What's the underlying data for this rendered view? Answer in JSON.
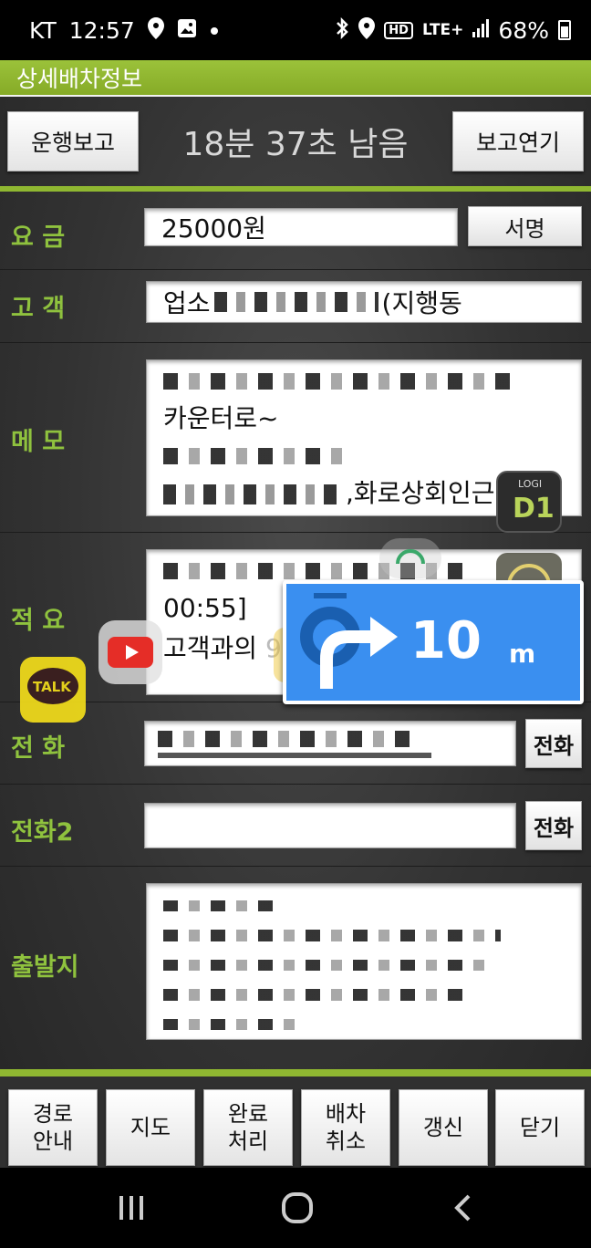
{
  "status_bar": {
    "carrier": "KT",
    "time": "12:57",
    "network": "LTE+",
    "hd": "HD",
    "battery": "68%"
  },
  "app": {
    "title": "상세배차정보",
    "report_button": "운행보고",
    "timer_text": "18분 37초 남음",
    "delay_button": "보고연기"
  },
  "fare": {
    "label": "요 금",
    "value": "25000원",
    "sign_button": "서명"
  },
  "customer": {
    "label": "고 객",
    "prefix": "업소",
    "suffix": "(지행동"
  },
  "memo": {
    "label": "메 모",
    "line2": "카운터로~",
    "line4_suffix": ",화로상회인근"
  },
  "summary": {
    "label": "적 요",
    "line2": "00:55]",
    "line3_prefix": "고객과의",
    "line3_partial": "909"
  },
  "phone": {
    "label": "전 화",
    "call_button": "전화"
  },
  "phone2": {
    "label": "전화2",
    "value": "",
    "call_button": "전화"
  },
  "departure": {
    "label": "출발지"
  },
  "bottom_buttons": [
    {
      "label": "경로\n안내"
    },
    {
      "label": "지도"
    },
    {
      "label": "완료\n처리"
    },
    {
      "label": "배차\n취소"
    },
    {
      "label": "갱신"
    },
    {
      "label": "닫기"
    }
  ],
  "nav_overlay": {
    "distance": "10",
    "unit": "m"
  },
  "floating_apps": {
    "talk_label": "TALK",
    "logi_label": "LOGI",
    "logi_sub": "D1"
  },
  "colors": {
    "accent_green": "#8fb731",
    "label_green": "#8fc23e",
    "nav_blue": "#3a8ff0"
  },
  "icons": {
    "status": [
      "location-pin-icon",
      "gallery-icon",
      "dot-icon",
      "bluetooth-icon",
      "location-icon",
      "signal-icon",
      "battery-icon"
    ],
    "nav": [
      "recent-apps-icon",
      "home-icon",
      "back-icon"
    ]
  }
}
